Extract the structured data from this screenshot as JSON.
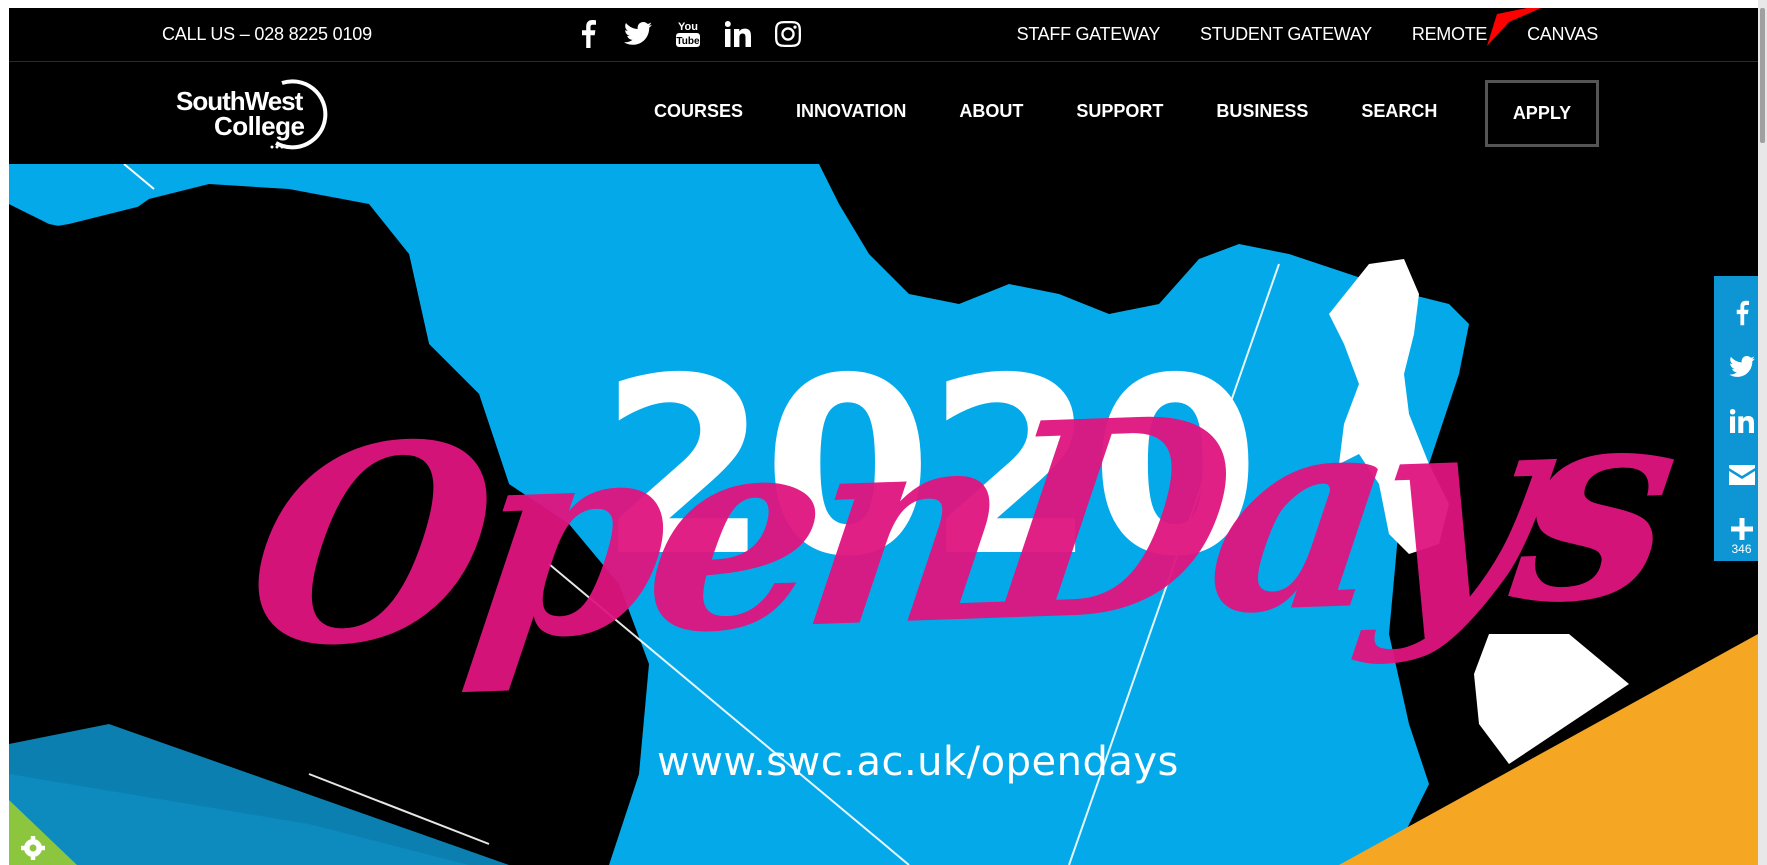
{
  "utility_bar": {
    "call_us": "CALL US – 028 8225 0109",
    "social_icons": [
      "facebook-icon",
      "twitter-icon",
      "youtube-icon",
      "linkedin-icon",
      "instagram-icon"
    ],
    "links": [
      "STAFF GATEWAY",
      "STUDENT GATEWAY",
      "REMOTE",
      "CANVAS"
    ]
  },
  "logo": {
    "line1": "SouthWest",
    "line2": "College"
  },
  "nav": {
    "items": [
      "COURSES",
      "INNOVATION",
      "ABOUT",
      "SUPPORT",
      "BUSINESS",
      "SEARCH"
    ],
    "apply_label": "APPLY"
  },
  "hero": {
    "year": "2020",
    "script": "OpenDays",
    "url": "www.swc.ac.uk/opendays"
  },
  "share_bar": {
    "icons": [
      "facebook-icon",
      "twitter-icon",
      "linkedin-icon",
      "email-icon",
      "plus-icon"
    ],
    "count": "346"
  },
  "colors": {
    "background": "#000000",
    "hero_blue": "#04a9ea",
    "hero_pink": "#e0157f",
    "hero_orange": "#f5a623",
    "share_blue": "#0d96d3",
    "cookie_green": "#8cc63f",
    "annotation_red": "#ff0000"
  }
}
